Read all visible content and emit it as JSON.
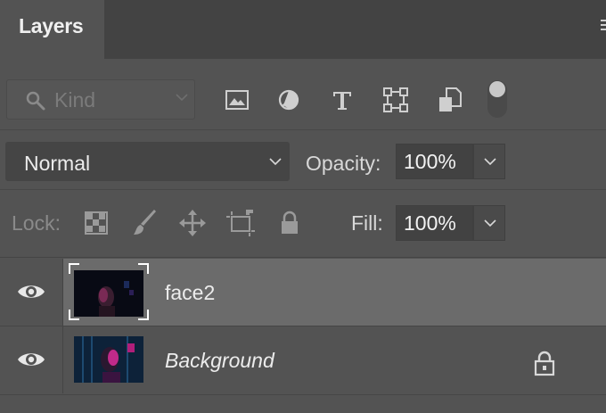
{
  "panel": {
    "tab_label": "Layers",
    "icons": {
      "panel_menu": "panel-menu-icon"
    }
  },
  "filter": {
    "kind_label": "Kind",
    "icons": [
      "search-icon",
      "pixel-layer-filter-icon",
      "adjustment-layer-filter-icon",
      "type-layer-filter-icon",
      "shape-layer-filter-icon",
      "smart-object-filter-icon",
      "filter-toggle"
    ]
  },
  "blend": {
    "mode": "Normal",
    "opacity_label": "Opacity:",
    "opacity_value": "100%"
  },
  "lock": {
    "label": "Lock:",
    "icons": [
      "lock-transparent-pixels-icon",
      "lock-image-pixels-icon",
      "lock-position-icon",
      "lock-artboard-icon",
      "lock-all-icon"
    ],
    "fill_label": "Fill:",
    "fill_value": "100%"
  },
  "layers": [
    {
      "name": "face2",
      "visible": true,
      "selected": true,
      "locked": false
    },
    {
      "name": "Background",
      "visible": true,
      "selected": false,
      "locked": true
    }
  ],
  "colors": {
    "panel_bg": "#535353",
    "tab_strip_bg": "#434343",
    "selected_row_bg": "#6b6b6b",
    "text": "#ececec",
    "dim_text": "#8a8a8a"
  }
}
